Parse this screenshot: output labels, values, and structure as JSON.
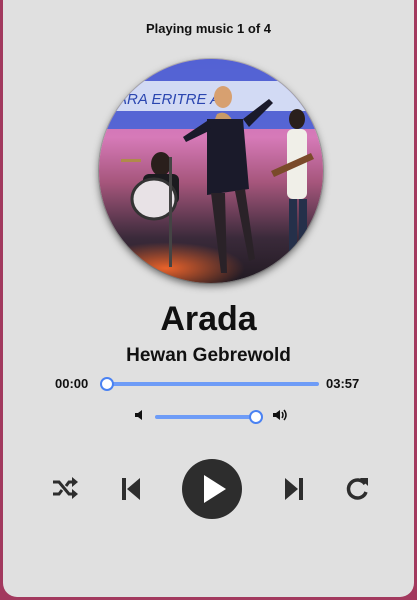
{
  "player": {
    "header": "Playing music 1 of 4",
    "album_art": {
      "banner_text": "ARA ERITRE A"
    },
    "track_title": "Arada",
    "artist": "Hewan Gebrewold",
    "current_time": "00:00",
    "duration": "03:57",
    "progress_fraction": 0.0,
    "volume_fraction": 0.95
  },
  "controls": {
    "icons": [
      "shuffle-icon",
      "skip-previous-icon",
      "play-icon",
      "skip-next-icon",
      "repeat-icon"
    ],
    "play_button_color": "#2d2d2d",
    "accent_color": "#4a82f2"
  },
  "colors": {
    "background": "#a2395e",
    "card": "#e0e0e0",
    "track": "#6e9cf7"
  }
}
